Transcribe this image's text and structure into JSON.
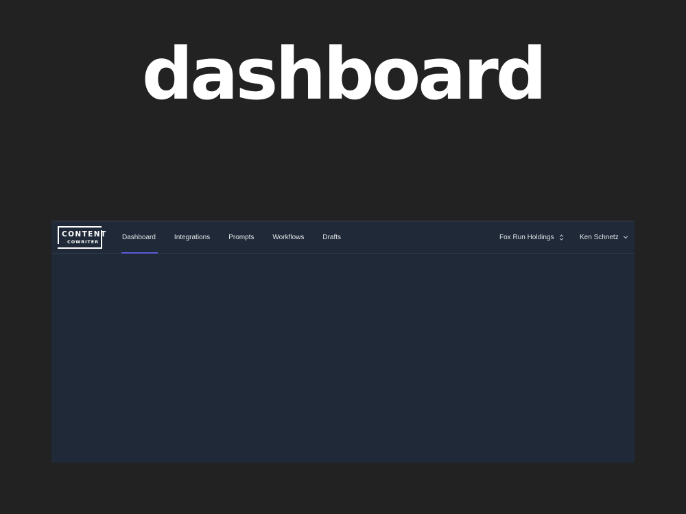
{
  "headline": "dashboard",
  "logo": {
    "line1": "CONTENT",
    "line2": "COWRITER"
  },
  "nav": {
    "tabs": [
      {
        "label": "Dashboard",
        "active": true
      },
      {
        "label": "Integrations",
        "active": false
      },
      {
        "label": "Prompts",
        "active": false
      },
      {
        "label": "Workflows",
        "active": false
      },
      {
        "label": "Drafts",
        "active": false
      }
    ]
  },
  "org_switcher": {
    "label": "Fox Run Holdings",
    "icon": "chevron-up-down-icon"
  },
  "user_menu": {
    "label": "Ken Schnetz",
    "icon": "chevron-down-icon"
  },
  "colors": {
    "page_background": "#222222",
    "app_background": "#1f2937",
    "active_tab_indicator": "#5b5bd6",
    "text": "#e5e7eb"
  }
}
